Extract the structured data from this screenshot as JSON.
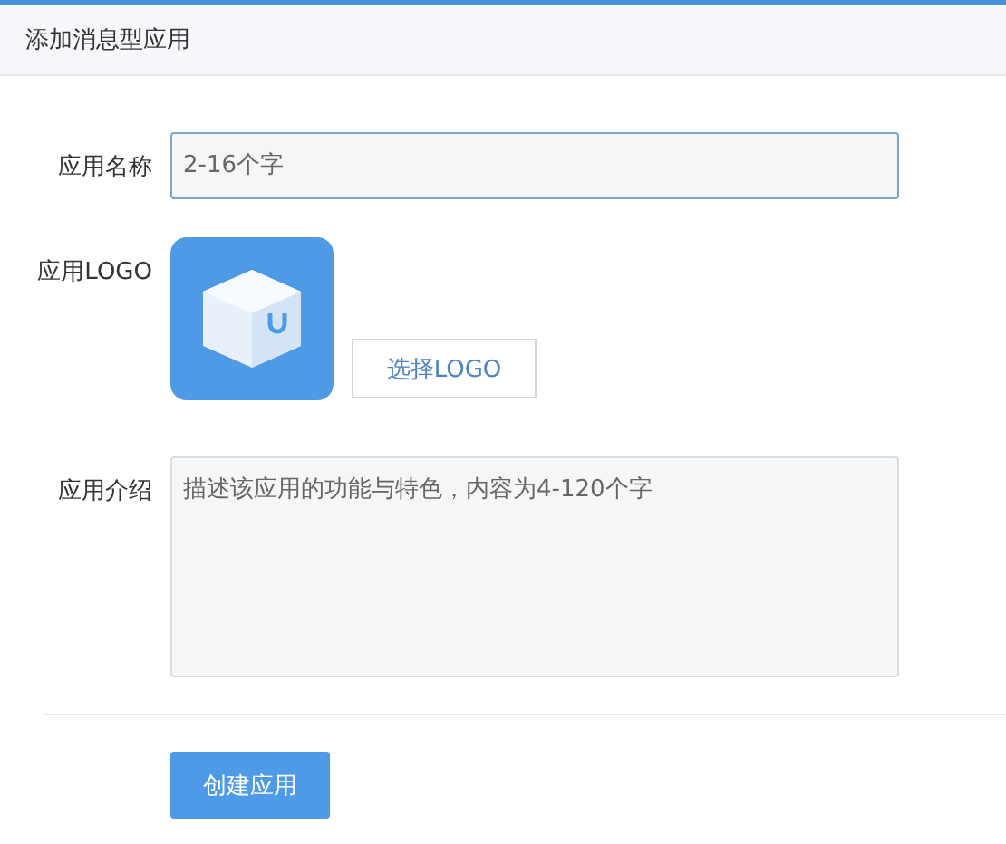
{
  "header": {
    "title": "添加消息型应用"
  },
  "name_field": {
    "label": "应用名称",
    "placeholder": "2-16个字"
  },
  "logo_field": {
    "label": "应用LOGO",
    "button": "选择LOGO"
  },
  "description_field": {
    "label": "应用介绍",
    "placeholder": "描述该应用的功能与特色，内容为4-120个字"
  },
  "submit": {
    "label": "创建应用"
  }
}
